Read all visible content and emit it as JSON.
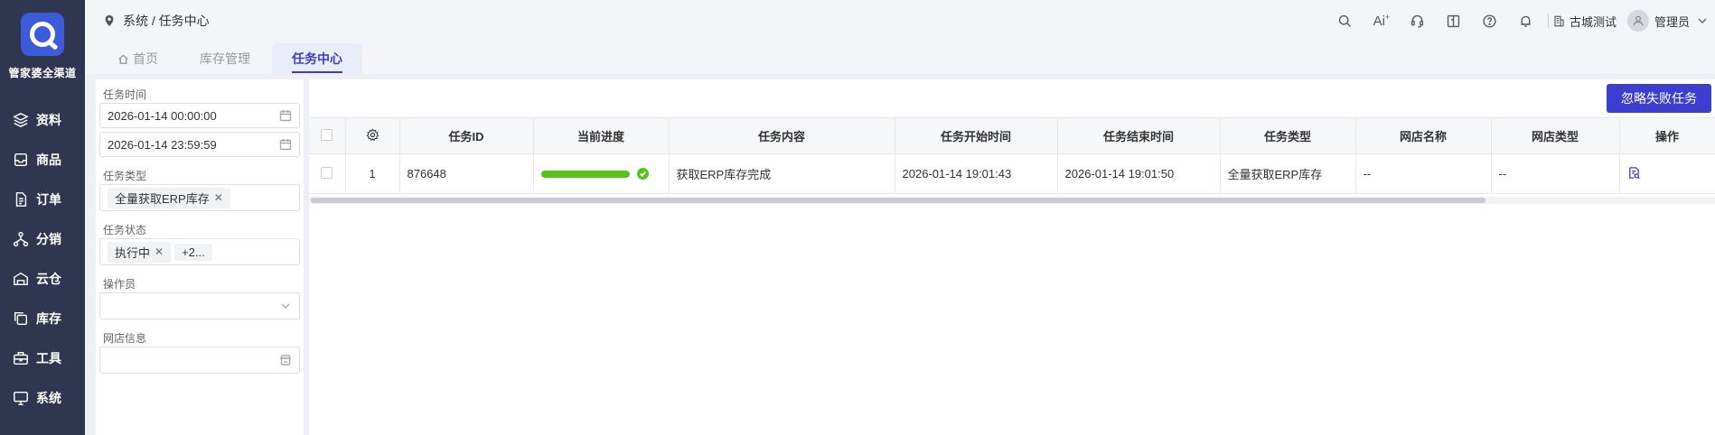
{
  "app": {
    "brand": "管家婆全渠道",
    "colors": {
      "sidebar": "#2e3650",
      "accent": "#3d3dd0",
      "success": "#52c41a",
      "logo": "#3b5bdb"
    }
  },
  "sidebar": {
    "items": [
      {
        "label": "资料",
        "icon": "layers-icon"
      },
      {
        "label": "商品",
        "icon": "inbox-icon"
      },
      {
        "label": "订单",
        "icon": "document-icon"
      },
      {
        "label": "分销",
        "icon": "network-icon"
      },
      {
        "label": "云仓",
        "icon": "warehouse-icon"
      },
      {
        "label": "库存",
        "icon": "copy-icon"
      },
      {
        "label": "工具",
        "icon": "toolbox-icon"
      },
      {
        "label": "系统",
        "icon": "monitor-icon"
      }
    ]
  },
  "header": {
    "breadcrumb": "系统 / 任务中心",
    "ai_label": "Ai",
    "store_name": "古城测试",
    "user_name": "管理员"
  },
  "tabs": [
    {
      "label": "首页",
      "icon": "home-icon"
    },
    {
      "label": "库存管理"
    },
    {
      "label": "任务中心",
      "active": true
    }
  ],
  "filters": {
    "task_time_label": "任务时间",
    "start_time": "2026-01-14 00:00:00",
    "end_time": "2026-01-14 23:59:59",
    "task_type_label": "任务类型",
    "task_type_tag": "全量获取ERP库存",
    "task_status_label": "任务状态",
    "task_status_tag": "执行中",
    "task_status_more": "+2...",
    "operator_label": "操作员",
    "operator_value": "",
    "shop_info_label": "网店信息",
    "shop_info_value": ""
  },
  "toolbar": {
    "ignore_failed_label": "忽略失败任务"
  },
  "table": {
    "columns": {
      "task_id": "任务ID",
      "progress": "当前进度",
      "content": "任务内容",
      "start": "任务开始时间",
      "end": "任务结束时间",
      "type": "任务类型",
      "shop_name": "网店名称",
      "shop_type": "网店类型",
      "action": "操作"
    },
    "rows": [
      {
        "index": "1",
        "task_id": "876648",
        "progress": 1.0,
        "content": "获取ERP库存完成",
        "start": "2026-01-14 19:01:43",
        "end": "2026-01-14 19:01:50",
        "type": "全量获取ERP库存",
        "shop_name": "--",
        "shop_type": "--"
      }
    ]
  }
}
